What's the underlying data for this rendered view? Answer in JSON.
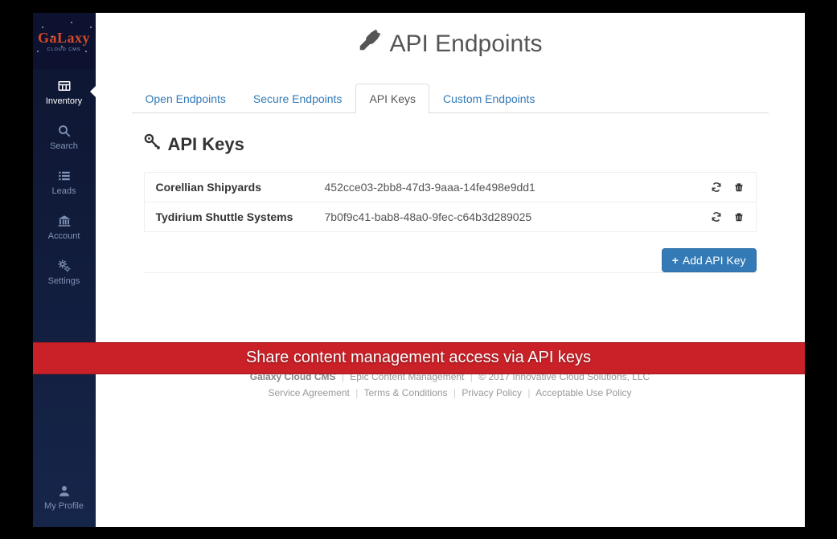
{
  "logo": {
    "main": "GaLaxy",
    "sub": "CLOUD CMS"
  },
  "sidebar": {
    "items": [
      {
        "label": "Inventory",
        "icon": "grid"
      },
      {
        "label": "Search",
        "icon": "search"
      },
      {
        "label": "Leads",
        "icon": "list"
      },
      {
        "label": "Account",
        "icon": "bank"
      },
      {
        "label": "Settings",
        "icon": "cogs"
      }
    ],
    "profile": {
      "label": "My Profile"
    }
  },
  "page": {
    "title": "API Endpoints"
  },
  "tabs": [
    {
      "label": "Open Endpoints"
    },
    {
      "label": "Secure Endpoints"
    },
    {
      "label": "API Keys"
    },
    {
      "label": "Custom Endpoints"
    }
  ],
  "activeTabIndex": 2,
  "section": {
    "title": "API Keys",
    "keys": [
      {
        "name": "Corellian Shipyards",
        "value": "452cce03-2bb8-47d3-9aaa-14fe498e9dd1"
      },
      {
        "name": "Tydirium Shuttle Systems",
        "value": "7b0f9c41-bab8-48a0-9fec-c64b3d289025"
      }
    ],
    "addButton": "Add API Key"
  },
  "banner": "Share content management access via API keys",
  "footer": {
    "brand": "Galaxy Cloud CMS",
    "tagline": "Epic Content Management",
    "copyright": "© 2017 Innovative Cloud Solutions, LLC",
    "links": [
      "Service Agreement",
      "Terms & Conditions",
      "Privacy Policy",
      "Acceptable Use Policy"
    ]
  }
}
